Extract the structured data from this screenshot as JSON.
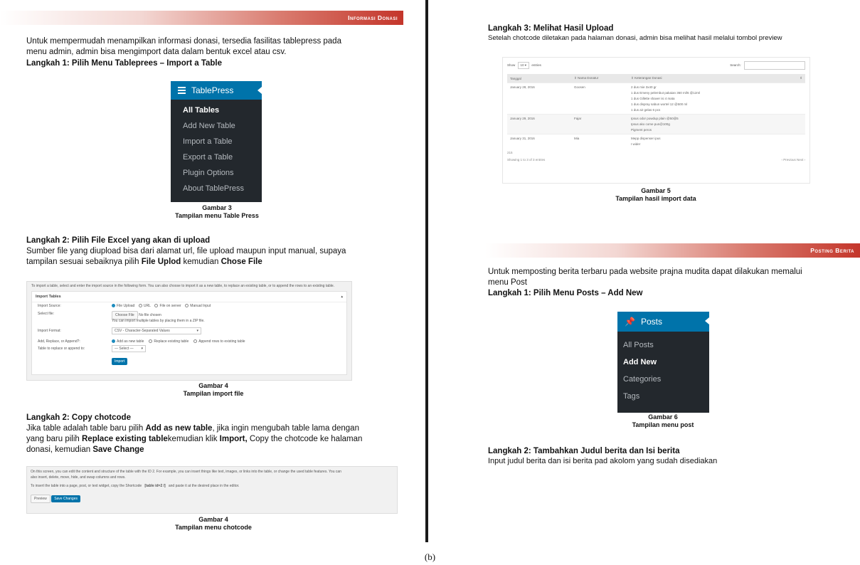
{
  "left": {
    "banner": "Informasi Donasi",
    "intro": [
      "Untuk mempermudah menampilkan informasi donasi, tersedia fasilitas tablepress pada",
      "menu admin, admin bisa mengimport data dalam bentuk excel atau csv."
    ],
    "step1": "Langkah 1: Pilih Menu Tableprees – Import a Table",
    "tablepress_menu": {
      "title": "TablePress",
      "items": [
        "All Tables",
        "Add New Table",
        "Import a Table",
        "Export a Table",
        "Plugin Options",
        "About TablePress"
      ]
    },
    "fig3": {
      "number": "Gambar 3",
      "title": "Tampilan menu Table Press"
    },
    "step2a": "Langkah 2: Pilih File Excel yang akan di upload",
    "step2a_text": {
      "line1": "Sumber file yang diupload  bisa dari alamat url, file upload maupun input manual, supaya",
      "line2_pre": "tampilan sesuai sebaiknya pilih ",
      "line2_b1": "File Uplod",
      "line2_mid": " kemudian ",
      "line2_b2": "Chose File"
    },
    "import_shot": {
      "top_note": "To import a table, select and enter the import source in the following form. You can also choose to import it as a new table, to replace an existing table, or to append the rows to an existing table.",
      "panel_title": "Import Tables",
      "row1_label": "Import Source:",
      "row1_opts": [
        "File Upload",
        "URL",
        "File on server",
        "Manual Input"
      ],
      "row2_label": "Select file:",
      "row2_button": "Choose File",
      "row2_nofile": "No file chosen",
      "row2_hint": "You can import multiple tables by placing them in a ZIP file.",
      "row3_label": "Import Format:",
      "row3_value": "CSV - Character-Separated Values",
      "row4_label": "Add, Replace, or Append?:",
      "row4_opts": [
        "Add as new table",
        "Replace existing table",
        "Append rows to existing table"
      ],
      "row5_label": "Table to replace or append to:",
      "row5_value": "— Select —",
      "button": "Import"
    },
    "fig4a": {
      "number": "Gambar 4",
      "title": "Tampilan import file"
    },
    "step2b": "Langkah 2: Copy chotcode",
    "step2b_text": {
      "l1_pre": "Jika table adalah table baru pilih ",
      "l1_b": "Add as new table",
      "l1_post": ", jika ingin mengubah table lama dengan",
      "l2_pre": "yang baru pilih ",
      "l2_b1": "Replace existing table",
      "l2_mid": "kemudian klik ",
      "l2_b2": "Import,",
      "l2_post": " Copy the chotcode ke halaman",
      "l3_pre": "donasi, kemudian ",
      "l3_b": "Save Change"
    },
    "shortcode_shot": {
      "line1": "On this screen, you can edit the content and structure of the table with the ID 2. For example, you can insert things like text, images, or links into the table, or change the used table features. You can",
      "line2": "also insert, delete, move, hide, and swap columns and rows.",
      "line3_pre": "To insert the table into a page, post, or text widget, copy the Shortcode",
      "line3_code": "[table id=2 /]",
      "line3_post": "and paste it at the desired place in the editor.",
      "btn_preview": "Preview",
      "btn_save": "Save Changes"
    },
    "fig4b": {
      "number": "Gambar 4",
      "title": "Tampilan menu chotcode"
    }
  },
  "right": {
    "step3": "Langkah 3: Melihat Hasil Upload",
    "step3_text": "Setelah chotcode diletakan pada halaman donasi, admin bisa melihat hasil melalui tombol preview",
    "result_shot": {
      "show_label": "Show",
      "show_value": "10",
      "entries_label": "entries",
      "search_label": "Search:",
      "headers": [
        "Tanggal",
        "Nama Donatur",
        "Keterangan Donasi"
      ],
      "rows": [
        {
          "date": "January 28, 2016",
          "name": "Goosen",
          "lines": [
            "2 dus mie 3x40 gr",
            "1 dus Emeny pelembut pakaian 360 ml/6 @12ml",
            "1 dus Gillette shaver isi 4 mata",
            "1 dus dispray sabun wortel 12 @500 ml",
            "1 dus air gelas 6 pcs"
          ]
        },
        {
          "date": "January 29, 2016",
          "name": "Fajar",
          "lines": [
            "Ipsus odor powdup plain @50@5",
            "Ipsus ako come pun@100g",
            "Pigment peros"
          ]
        },
        {
          "date": "January 31, 2016",
          "name": "Mia",
          "lines": [
            "Mepp dispenser ipus",
            "I wider"
          ]
        }
      ],
      "footer_left_top": "215",
      "footer_left": "Showing 1 to 3 of 3 entries",
      "footer_right": "‹ Previous  Next ›"
    },
    "fig5": {
      "number": "Gambar 5",
      "title": "Tampilan hasil import data"
    },
    "banner": "Posting Berita",
    "intro": [
      "Untuk memposting berita terbaru pada website prajna mudita dapat dilakukan memalui",
      "menu Post"
    ],
    "step1": "Langkah 1: Pilih Menu Posts – Add New",
    "posts_menu": {
      "title": "Posts",
      "items": [
        "All Posts",
        "Add New",
        "Categories",
        "Tags"
      ]
    },
    "fig6": {
      "number": "Gambar 6",
      "title": "Tampilan menu post"
    },
    "step2": "Langkah 2: Tambahkan Judul berita dan  Isi berita",
    "step2_text": "Input judul berita dan isi berita pad akolom yang sudah disediakan"
  },
  "bottom_label": "(b)"
}
